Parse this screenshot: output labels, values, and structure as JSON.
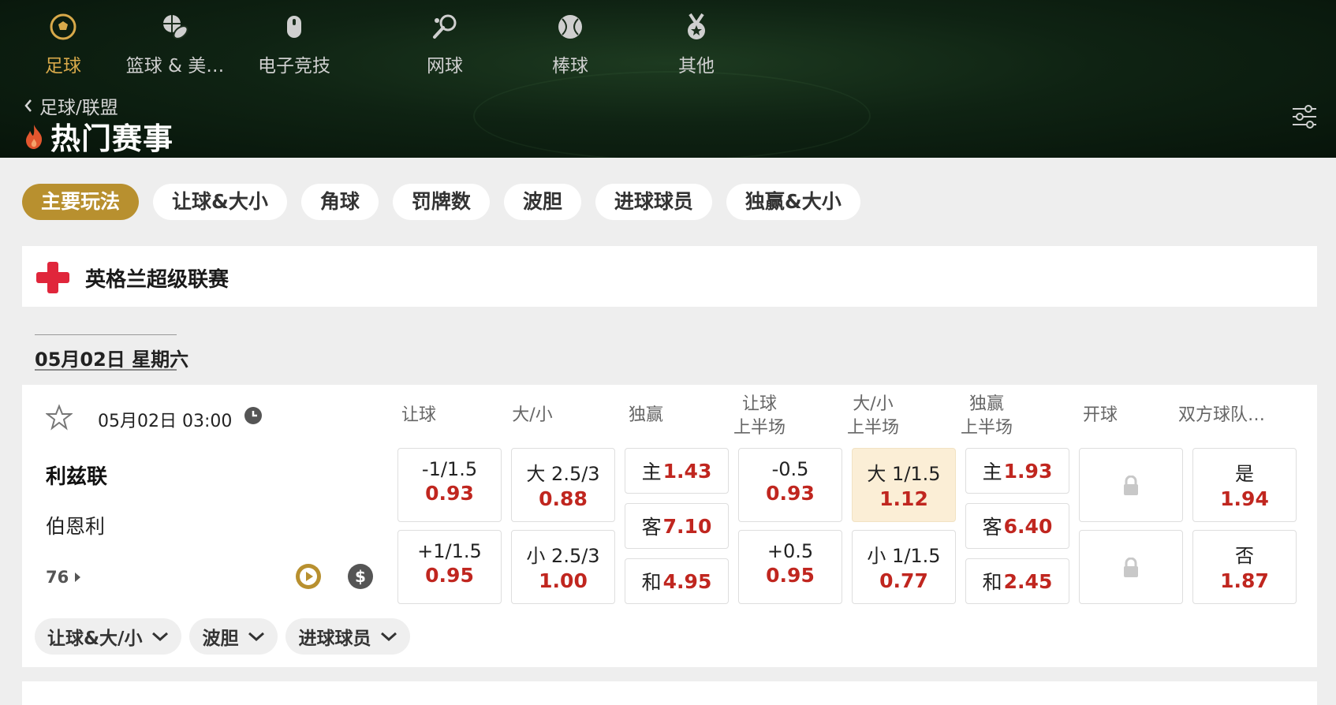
{
  "sport_tabs": [
    {
      "label": "足球",
      "icon": "soccer-ball-icon",
      "active": true
    },
    {
      "label": "篮球 & 美…",
      "icon": "basketball-football-icon",
      "active": false
    },
    {
      "label": "电子竞技",
      "icon": "esports-mouse-icon",
      "active": false
    },
    {
      "label": "网球",
      "icon": "tennis-racket-icon",
      "active": false
    },
    {
      "label": "棒球",
      "icon": "baseball-icon",
      "active": false
    },
    {
      "label": "其他",
      "icon": "medal-icon",
      "active": false
    }
  ],
  "breadcrumb": "足球/联盟",
  "page_title": "热门赛事",
  "market_filters": [
    "主要玩法",
    "让球&大小",
    "角球",
    "罚牌数",
    "波胆",
    "进球球员",
    "独赢&大小"
  ],
  "active_filter": "主要玩法",
  "league": {
    "name": "英格兰超级联赛",
    "flag_icon": "england-flag-icon"
  },
  "date_header": "05月02日 星期六",
  "match": {
    "kickoff": "05月02日 03:00",
    "home": "利兹联",
    "away": "伯恩利",
    "more_markets": "76",
    "columns": [
      {
        "line1": "让球",
        "line2": ""
      },
      {
        "line1": "大/小",
        "line2": ""
      },
      {
        "line1": "独赢",
        "line2": ""
      },
      {
        "line1": "让球",
        "line2": "上半场"
      },
      {
        "line1": "大/小",
        "line2": "上半场"
      },
      {
        "line1": "独赢",
        "line2": "上半场"
      },
      {
        "line1": "开球",
        "line2": ""
      },
      {
        "line1": "双方球队…",
        "line2": ""
      }
    ],
    "handicap": [
      {
        "line": "-1/1.5",
        "price": "0.93"
      },
      {
        "line": "+1/1.5",
        "price": "0.95"
      }
    ],
    "over_under": [
      {
        "line": "大 2.5/3",
        "price": "0.88"
      },
      {
        "line": "小 2.5/3",
        "price": "1.00"
      }
    ],
    "moneyline": [
      {
        "line": "主",
        "price": "1.43"
      },
      {
        "line": "客",
        "price": "7.10"
      },
      {
        "line": "和",
        "price": "4.95"
      }
    ],
    "handicap_1h": [
      {
        "line": "-0.5",
        "price": "0.93"
      },
      {
        "line": "+0.5",
        "price": "0.95"
      }
    ],
    "over_under_1h": [
      {
        "line": "大 1/1.5",
        "price": "1.12"
      },
      {
        "line": "小 1/1.5",
        "price": "0.77"
      }
    ],
    "moneyline_1h": [
      {
        "line": "主",
        "price": "1.93"
      },
      {
        "line": "客",
        "price": "6.40"
      },
      {
        "line": "和",
        "price": "2.45"
      }
    ],
    "both_teams": [
      {
        "line": "是",
        "price": "1.94"
      },
      {
        "line": "否",
        "price": "1.87"
      }
    ],
    "sub_filters": [
      "让球&大/小",
      "波胆",
      "进球球员"
    ]
  },
  "colors": {
    "accent_gold": "#b8902f",
    "tab_active": "#d8a94a",
    "price_red": "#c0261f",
    "highlight": "#fbeed6"
  }
}
